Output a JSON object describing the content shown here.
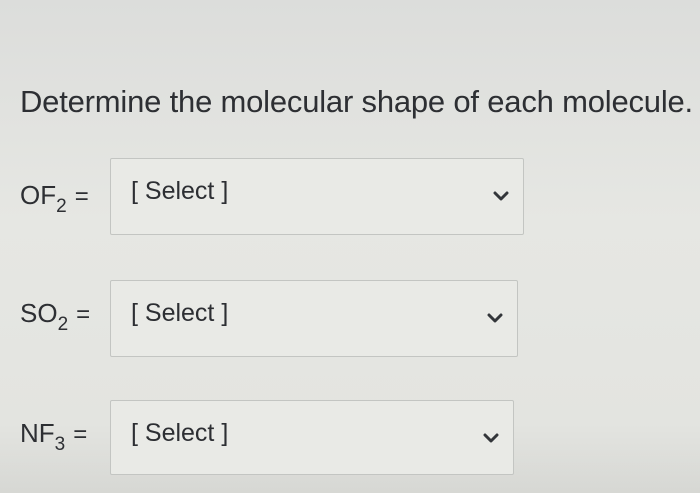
{
  "question": {
    "prompt": "Determine the molecular shape of each molecule."
  },
  "rows": [
    {
      "formula_base": "OF",
      "formula_sub": "2",
      "equals": "=",
      "selected": "[ Select ]",
      "chevron_icon": "chevron-down-icon"
    },
    {
      "formula_base": "SO",
      "formula_sub": "2",
      "equals": "=",
      "selected": "[ Select ]",
      "chevron_icon": "chevron-down-icon"
    },
    {
      "formula_base": "NF",
      "formula_sub": "3",
      "equals": "=",
      "selected": "[ Select ]",
      "chevron_icon": "chevron-down-icon"
    }
  ],
  "colors": {
    "background": "#e3e4e0",
    "text": "#2d2f33",
    "dropdown_border": "#c3c5c2"
  }
}
